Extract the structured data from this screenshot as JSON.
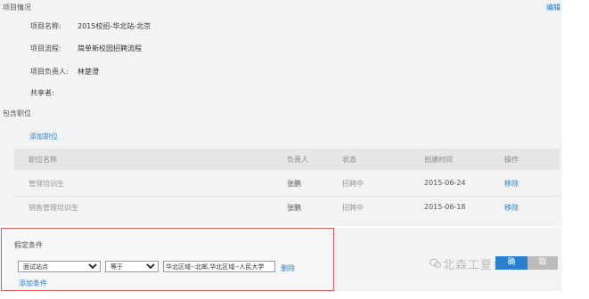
{
  "project_info": {
    "section_title": "项目情况",
    "edit_label": "编辑",
    "rows": [
      {
        "label": "项目名称:",
        "value": "2015校招-华北站-北京"
      },
      {
        "label": "项目流程:",
        "value": "简单新校园招聘流程"
      },
      {
        "label": "项目负责人:",
        "value": "林楚澄"
      },
      {
        "label": "共享者:",
        "value": ""
      }
    ]
  },
  "positions": {
    "section_title": "包含职位",
    "add_link": "添加职位",
    "headers": {
      "name": "职位名称",
      "owner": "负责人",
      "status": "状态",
      "created": "创建时间",
      "actions": "操作"
    },
    "rows": [
      {
        "name": "管理培训生",
        "owner": "张鹏",
        "status": "招聘中",
        "created": "2015-06-24",
        "action": "移除"
      },
      {
        "name": "销售管理培训生",
        "owner": "张鹏",
        "status": "招聘中",
        "created": "2015-06-18",
        "action": "移除"
      }
    ]
  },
  "filter": {
    "section_title": "假定条件",
    "field_select": "面试站点",
    "operator_select": "等于",
    "value_input": "华北区域--北邮,华北区域--人民大学",
    "remove_label": "删除",
    "add_condition": "添加条件"
  },
  "footer": {
    "confirm_label": "确",
    "cancel_label": "取",
    "watermark": "北森工夏会"
  },
  "colors": {
    "accent": "#2a7fd0",
    "highlight_border": "#e05a5a",
    "band": "#f3f3f3"
  }
}
